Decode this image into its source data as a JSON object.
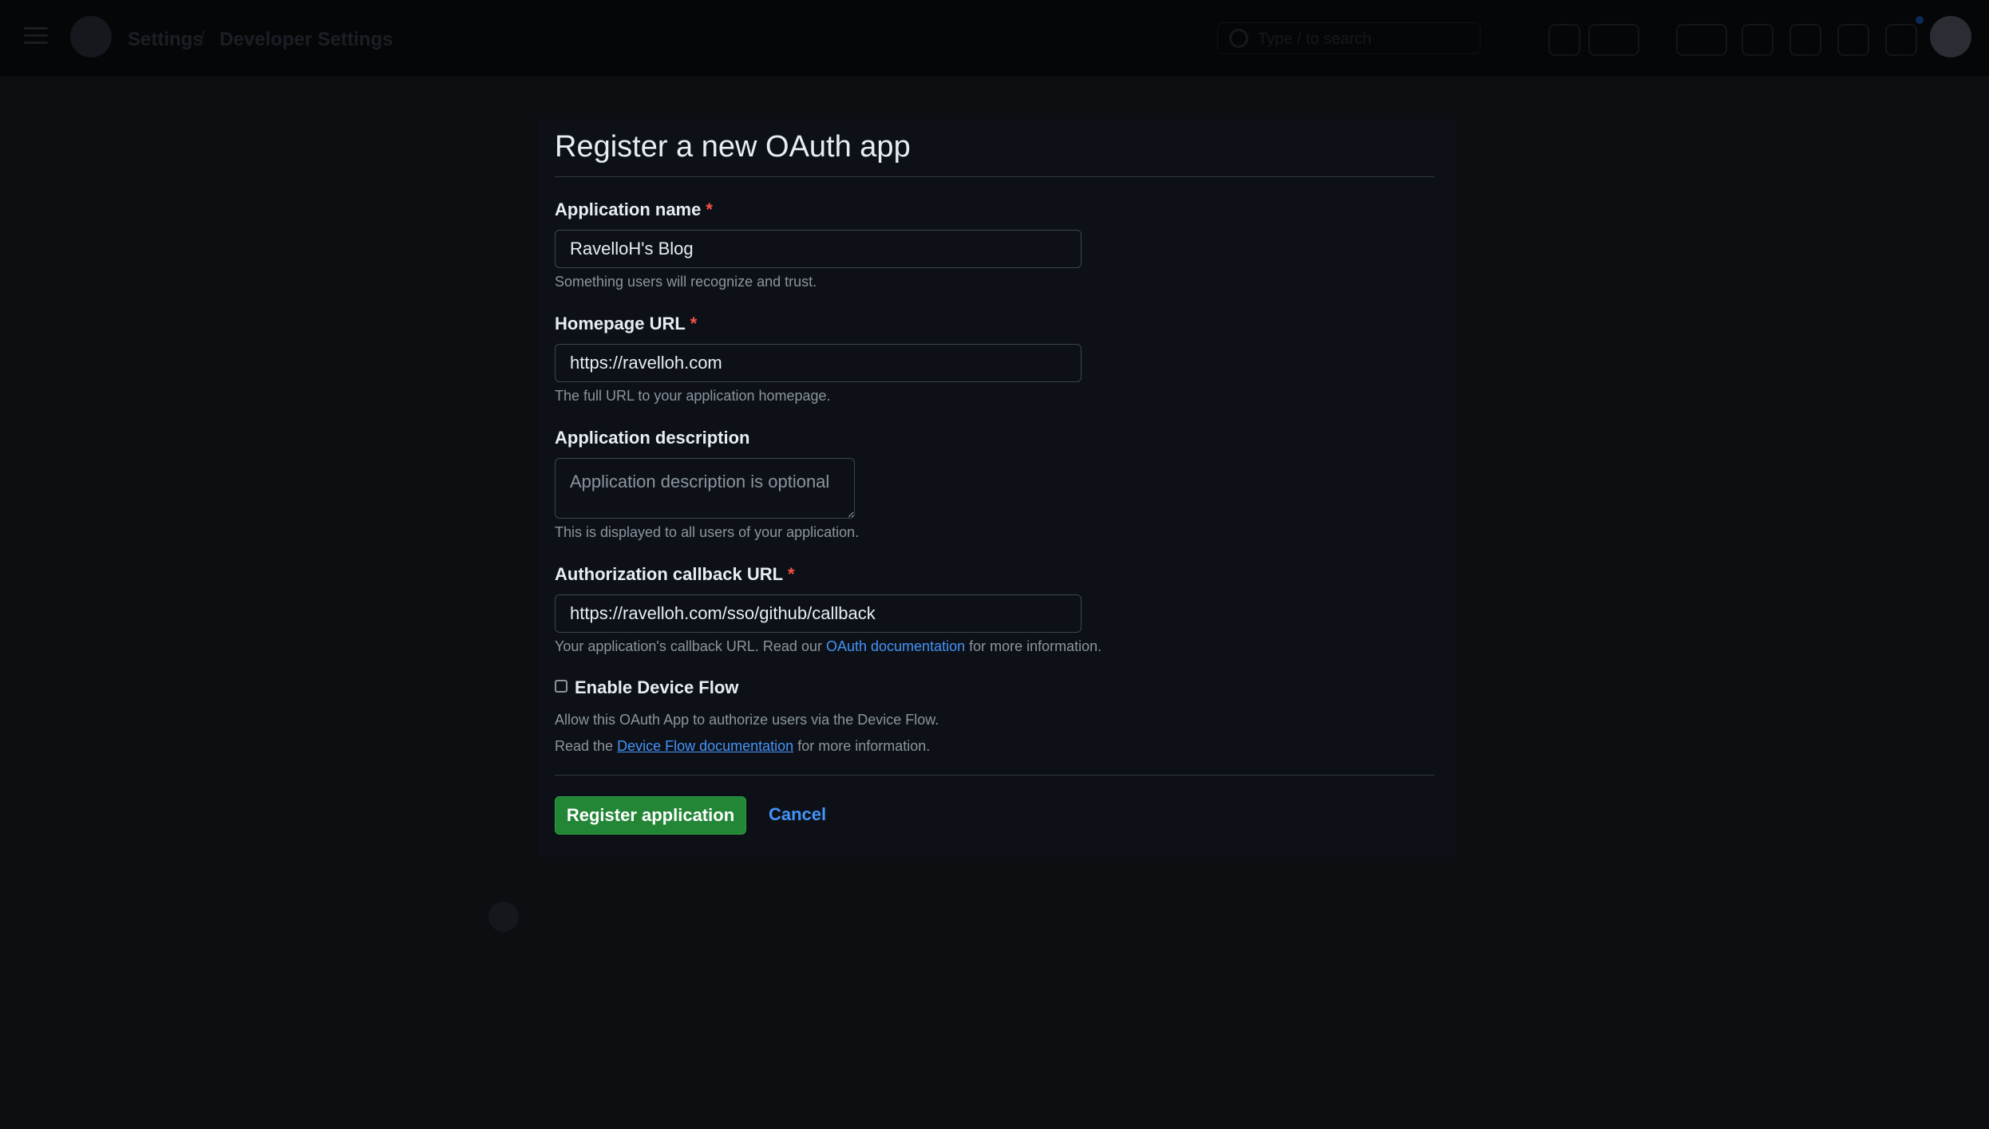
{
  "header": {
    "crumbs": [
      "Settings",
      "Developer Settings"
    ],
    "search_placeholder": "Type / to search"
  },
  "form": {
    "title": "Register a new OAuth app",
    "app_name": {
      "label": "Application name",
      "required_mark": "*",
      "value": "RavelloH's Blog",
      "hint": "Something users will recognize and trust."
    },
    "homepage": {
      "label": "Homepage URL",
      "required_mark": "*",
      "value": "https://ravelloh.com",
      "hint": "The full URL to your application homepage."
    },
    "description": {
      "label": "Application description",
      "placeholder": "Application description is optional",
      "hint": "This is displayed to all users of your application."
    },
    "callback": {
      "label": "Authorization callback URL",
      "required_mark": "*",
      "value": "https://ravelloh.com/sso/github/callback",
      "hint_prefix": "Your application's callback URL. Read our",
      "hint_link": "OAuth documentation",
      "hint_suffix": "for more information."
    },
    "device_flow": {
      "label": "Enable Device Flow",
      "checked": false,
      "hint_line1": "Allow this OAuth App to authorize users via the Device Flow.",
      "hint_line2_prefix": "Read the",
      "hint_line2_link": "Device Flow documentation",
      "hint_line2_suffix": "for more information."
    },
    "register_label": "Register application",
    "cancel_label": "Cancel"
  },
  "colors": {
    "primary_button": "#238636",
    "link": "#4493f8",
    "required": "#f85149",
    "background": "#0d1117"
  }
}
